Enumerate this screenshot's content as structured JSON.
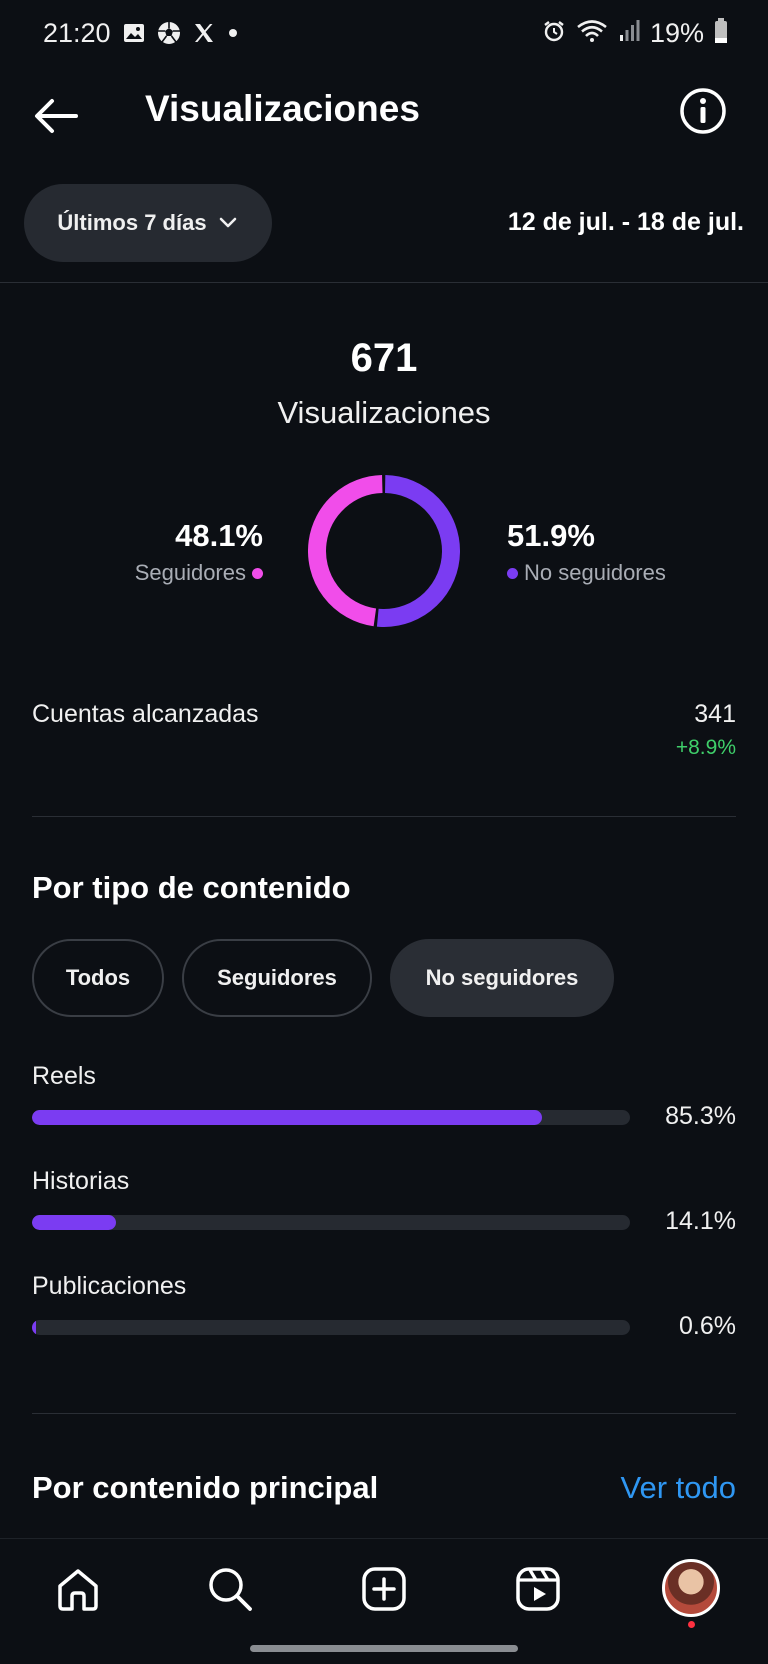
{
  "status_bar": {
    "time": "21:20",
    "battery": "19%",
    "left_icons": [
      "gallery-icon",
      "soccer-ball-icon",
      "x-logo-icon",
      "dot-icon"
    ],
    "right_icons": [
      "alarm-icon",
      "wifi-icon",
      "signal-icon",
      "battery-icon"
    ]
  },
  "header": {
    "title": "Visualizaciones",
    "back_icon": "arrow-left-icon",
    "info_icon": "info-icon"
  },
  "period": {
    "selected": "Últimos 7 días",
    "date_range": "12 de jul. - 18 de jul."
  },
  "summary": {
    "total": "671",
    "total_label": "Visualizaciones",
    "followers_pct": "48.1%",
    "followers_label": "Seguidores",
    "non_followers_pct": "51.9%",
    "non_followers_label": "No seguidores",
    "followers_color": "#f14dea",
    "non_followers_color": "#7b3cf2"
  },
  "reached": {
    "label": "Cuentas alcanzadas",
    "value": "341",
    "change": "+8.9%",
    "change_color": "#3fcf6a"
  },
  "content_type": {
    "title": "Por tipo de contenido",
    "filters": [
      {
        "label": "Todos",
        "active": false
      },
      {
        "label": "Seguidores",
        "active": false
      },
      {
        "label": "No seguidores",
        "active": true
      }
    ],
    "items": [
      {
        "label": "Reels",
        "pct": "85.3%",
        "fraction": 0.853
      },
      {
        "label": "Historias",
        "pct": "14.1%",
        "fraction": 0.141
      },
      {
        "label": "Publicaciones",
        "pct": "0.6%",
        "fraction": 0.006
      }
    ],
    "bar_color": "#7b3cf2"
  },
  "top_content": {
    "title": "Por contenido principal",
    "see_all": "Ver todo",
    "link_color": "#2f97f3"
  },
  "nav": {
    "items": [
      "home-icon",
      "search-icon",
      "create-icon",
      "reels-icon",
      "profile-avatar"
    ]
  }
}
